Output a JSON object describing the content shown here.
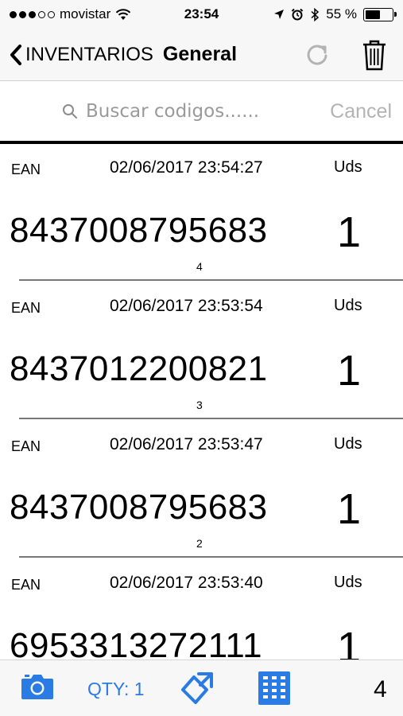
{
  "status": {
    "carrier": "movistar",
    "time": "23:54",
    "battery": "55 %",
    "battery_level": 0.55
  },
  "nav": {
    "back_label": "INVENTARIOS",
    "title": "General"
  },
  "search": {
    "placeholder": "Buscar codigos......",
    "cancel_label": "Cancel"
  },
  "entries": [
    {
      "type": "EAN",
      "datetime": "02/06/2017 23:54:27",
      "unit": "Uds",
      "code": "8437008795683",
      "qty": "1",
      "index": "4"
    },
    {
      "type": "EAN",
      "datetime": "02/06/2017 23:53:54",
      "unit": "Uds",
      "code": "8437012200821",
      "qty": "1",
      "index": "3"
    },
    {
      "type": "EAN",
      "datetime": "02/06/2017 23:53:47",
      "unit": "Uds",
      "code": "8437008795683",
      "qty": "1",
      "index": "2"
    },
    {
      "type": "EAN",
      "datetime": "02/06/2017 23:53:40",
      "unit": "Uds",
      "code": "6953313272111",
      "qty": "1",
      "index": ""
    }
  ],
  "toolbar": {
    "qty_label": "QTY: 1",
    "count": "4",
    "accent": "#2a7be4",
    "icons": [
      "camera-icon",
      "scan-rotate-icon",
      "keypad-icon"
    ]
  }
}
